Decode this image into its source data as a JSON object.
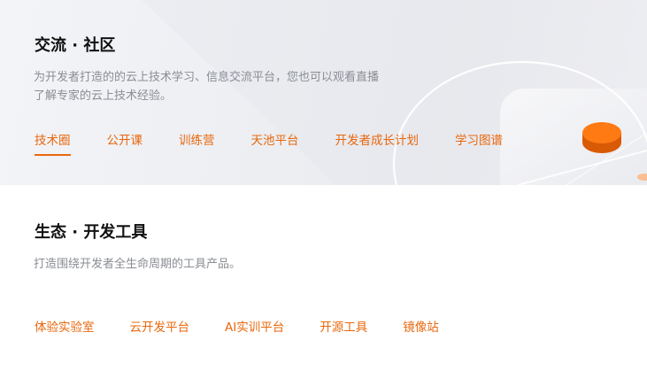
{
  "community": {
    "title": "交流 · 社区",
    "desc_line1": "为开发者打造的的云上技术学习、信息交流平台，您也可以观看直播",
    "desc_line2": "了解专家的云上技术经验。",
    "links": [
      "技术圈",
      "公开课",
      "训练营",
      "天池平台",
      "开发者成长计划",
      "学习图谱"
    ],
    "active_index": 0
  },
  "tools": {
    "title": "生态 · 开发工具",
    "desc": "打造围绕开发者全生命周期的工具产品。",
    "links": [
      "体验实验室",
      "云开发平台",
      "AI实训平台",
      "开源工具",
      "镜像站"
    ]
  },
  "colors": {
    "accent": "#e8680e",
    "hero_bg": "#eceef2",
    "desc_text": "#8a8d93"
  }
}
